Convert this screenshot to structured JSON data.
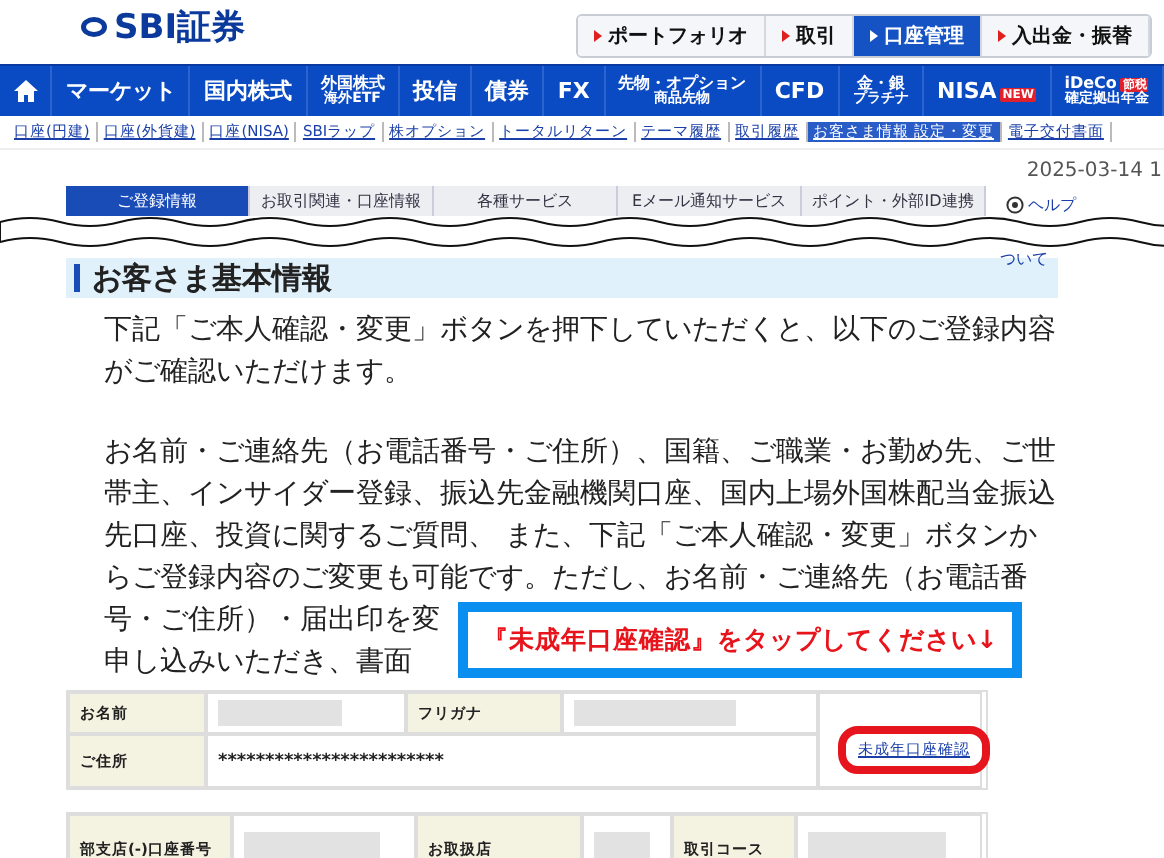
{
  "header": {
    "logo": "SBI証券",
    "top_buttons": [
      {
        "label": "ポートフォリオ",
        "selected": false
      },
      {
        "label": "取引",
        "selected": false
      },
      {
        "label": "口座管理",
        "selected": true
      },
      {
        "label": "入出金・振替",
        "selected": false
      }
    ]
  },
  "main_nav": [
    {
      "kind": "home"
    },
    {
      "kind": "text",
      "lines": [
        "マーケット"
      ]
    },
    {
      "kind": "text",
      "lines": [
        "国内株式"
      ]
    },
    {
      "kind": "text",
      "lines": [
        "外国株式",
        "海外ETF"
      ]
    },
    {
      "kind": "text",
      "lines": [
        "投信"
      ]
    },
    {
      "kind": "text",
      "lines": [
        "債券"
      ]
    },
    {
      "kind": "text",
      "lines": [
        "FX"
      ]
    },
    {
      "kind": "text",
      "lines": [
        "先物・オプション",
        "商品先物"
      ]
    },
    {
      "kind": "text",
      "lines": [
        "CFD"
      ]
    },
    {
      "kind": "text",
      "lines": [
        "金・銀",
        "プラチナ"
      ]
    },
    {
      "kind": "text",
      "lines": [
        "NISA"
      ],
      "badge": "NEW"
    },
    {
      "kind": "text",
      "lines": [
        "iDeCo",
        "確定拠出年金"
      ],
      "badge": "節税"
    }
  ],
  "sub_nav": [
    {
      "label": "口座(円建)",
      "selected": false
    },
    {
      "label": "口座(外貨建)",
      "selected": false
    },
    {
      "label": "口座(NISA)",
      "selected": false
    },
    {
      "label": "SBIラップ",
      "selected": false
    },
    {
      "label": "株オプション",
      "selected": false
    },
    {
      "label": "トータルリターン",
      "selected": false
    },
    {
      "label": "テーマ履歴",
      "selected": false
    },
    {
      "label": "取引履歴",
      "selected": false
    },
    {
      "label": "お客さま情報 設定・変更",
      "selected": true
    },
    {
      "label": "電子交付書面",
      "selected": false
    }
  ],
  "date": "2025-03-14 1",
  "tabs": [
    {
      "label": "ご登録情報",
      "selected": true
    },
    {
      "label": "お取引関連・口座情報",
      "selected": false
    },
    {
      "label": "各種サービス",
      "selected": false
    },
    {
      "label": "Eメール通知サービス",
      "selected": false
    },
    {
      "label": "ポイント・外部ID連携",
      "selected": false
    }
  ],
  "help": {
    "label": "ヘルプ",
    "continuation": "ついて"
  },
  "section_title": "お客さま基本情報",
  "paragraphs": [
    [
      "下記「ご本人確認・変更」ボタンを押下していただくと、以下のご登録内容",
      "がご確認いただけます。"
    ],
    [
      "お名前・ご連絡先（お電話番号・ご住所）、国籍、ご職業・お勤め先、ご世",
      "帯主、インサイダー登録、振込先金融機関口座、国内上場外国株配当金振込",
      "先口座、投資に関するご質問、 また、下記「ご本人確認・変更」ボタンか",
      "らご登録内容のご変更も可能です。ただし、お名前・ご連絡先（お電話番",
      "号・ご住所）・届出印を変",
      "申し込みいただき、書面"
    ]
  ],
  "callout": "『未成年口座確認』をタップしてください↓",
  "basic_table": {
    "name_label": "お名前",
    "furigana_label": "フリガナ",
    "address_label": "ご住所",
    "address_value": "************************",
    "link": "未成年口座確認"
  },
  "account_table": [
    {
      "kind": "label",
      "text": "部支店(-)口座番号"
    },
    {
      "kind": "redacted"
    },
    {
      "kind": "label",
      "text": "お取扱店"
    },
    {
      "kind": "redacted"
    },
    {
      "kind": "label",
      "text": "取引コース"
    },
    {
      "kind": "redacted"
    }
  ]
}
